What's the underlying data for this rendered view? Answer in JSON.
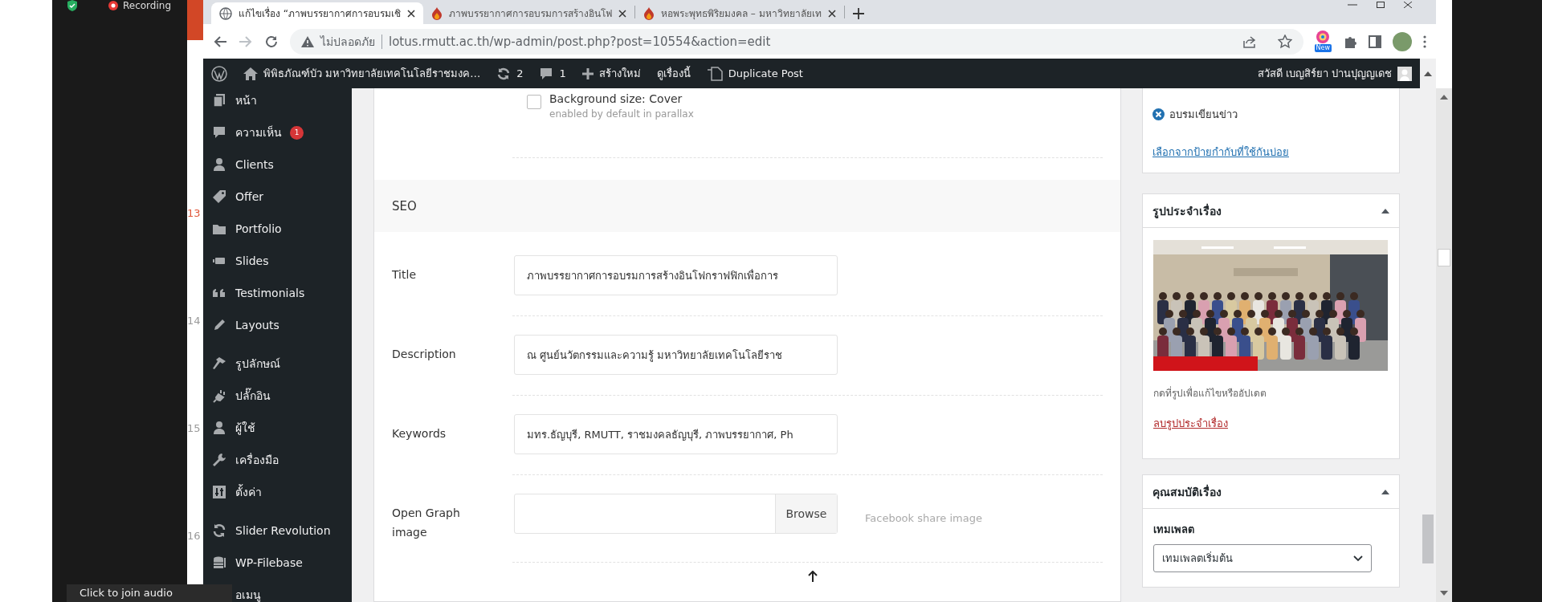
{
  "meeting": {
    "recording_label": "Recording",
    "join_audio_tooltip": "Click to join audio"
  },
  "slide_strip": {
    "line_numbers": [
      {
        "text": "13",
        "color": "#e0583a"
      },
      {
        "text": "14",
        "color": "#9a9a9a"
      },
      {
        "text": "15",
        "color": "#9a9a9a"
      },
      {
        "text": "16",
        "color": "#9a9a9a"
      }
    ]
  },
  "browser": {
    "tabs": [
      {
        "title": "แก้ไขเรื่อง “ภาพบรรยากาศการอบรมเชิ",
        "selected": true,
        "kind": "globe"
      },
      {
        "title": "ภาพบรรยากาศการอบรมการสร้างอินโฟ",
        "selected": false,
        "kind": "site"
      },
      {
        "title": "หอพระพุทธพิริยมงคล – มหาวิทยาลัยเท",
        "selected": false,
        "kind": "site"
      }
    ],
    "security_label": "ไม่ปลอดภัย",
    "url": "lotus.rmutt.ac.th/wp-admin/post.php?post=10554&action=edit",
    "extension_badge": "New"
  },
  "admin_bar": {
    "site_name": "พิพิธภัณฑ์บัว มหาวิทยาลัยเทคโนโลยีราชมงค…",
    "updates": "2",
    "comments": "1",
    "new_label": "สร้างใหม่",
    "view_label": "ดูเรื่องนี้",
    "duplicate_label": "Duplicate Post",
    "greeting": "สวัสดี เบญสิร์ยา ปานปุญญเดช"
  },
  "sidebar": {
    "groups": [
      {
        "items": [
          {
            "label": "หน้า",
            "kind": "pages"
          },
          {
            "label": "ความเห็น",
            "kind": "comments",
            "badge": "1"
          },
          {
            "label": "Clients",
            "kind": "clients"
          },
          {
            "label": "Offer",
            "kind": "offer"
          },
          {
            "label": "Portfolio",
            "kind": "portfolio"
          },
          {
            "label": "Slides",
            "kind": "slides"
          },
          {
            "label": "Testimonials",
            "kind": "testimonials"
          },
          {
            "label": "Layouts",
            "kind": "layouts"
          }
        ]
      },
      {
        "items": [
          {
            "label": "รูปลักษณ์",
            "kind": "appearance"
          },
          {
            "label": "ปลั๊กอิน",
            "kind": "plugins"
          },
          {
            "label": "ผู้ใช้",
            "kind": "users"
          },
          {
            "label": "เครื่องมือ",
            "kind": "tools"
          },
          {
            "label": "ตั้งค่า",
            "kind": "settings"
          }
        ]
      },
      {
        "items": [
          {
            "label": "Slider Revolution",
            "kind": "slider"
          },
          {
            "label": "WP-Filebase",
            "kind": "filebase"
          },
          {
            "label": "อเมนู",
            "kind": "collapse"
          }
        ]
      }
    ]
  },
  "post_options": {
    "background_option": {
      "label": "Background size: Cover",
      "hint": "enabled by default in parallax",
      "checked": false
    },
    "seo": {
      "heading": "SEO",
      "fields": [
        {
          "label": "Title",
          "kind": "text",
          "value": "ภาพบรรยากาศการอบรมการสร้างอินโฟกราฟฟิกเพื่อการ"
        },
        {
          "label": "Description",
          "kind": "text",
          "value": "ณ ศูนย์นวัตกรรมและความรู้ มหาวิทยาลัยเทคโนโลยีราช"
        },
        {
          "label": "Keywords",
          "kind": "text",
          "value": "มทร.ธัญบุรี, RMUTT, ราชมงคลธัญบุรี, ภาพบรรยากาศ, Ph"
        },
        {
          "label": "Open Graph image",
          "kind": "file",
          "button": "Browse",
          "hint": "Facebook share image"
        }
      ]
    }
  },
  "tags_box": {
    "tags": [
      {
        "label": "อบรมเขียนข่าว"
      }
    ],
    "choose_link": "เลือกจากป้ายกำกับที่ใช้กันบ่อย"
  },
  "featured_image_box": {
    "title": "รูปประจำเรื่อง",
    "caption": "กดที่รูปเพื่อแก้ไขหรืออัปเดต",
    "remove_link": "ลบรูปประจำเรื่อง"
  },
  "attributes_box": {
    "title": "คุณสมบัติเรื่อง",
    "template_label": "เทมเพลต",
    "template_value": "เทมเพลตเริ่มต้น"
  }
}
